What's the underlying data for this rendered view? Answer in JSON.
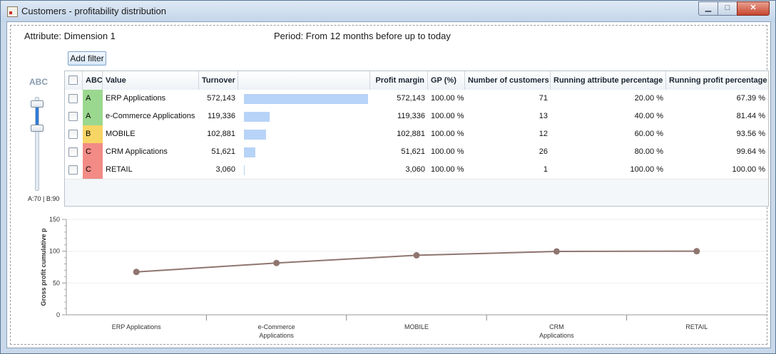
{
  "window": {
    "title": "Customers - profitability distribution",
    "minimize": "▁",
    "maximize": "□",
    "close": "✕"
  },
  "header": {
    "attribute": "Attribute: Dimension 1",
    "period": "Period: From 12 months before up to today"
  },
  "toolbar": {
    "add_filter": "Add filter"
  },
  "abc_slider": {
    "label": "ABC",
    "readout": "A:70 | B:90",
    "a_threshold": 70,
    "b_threshold": 90
  },
  "colors": {
    "A": "#9bd88f",
    "B": "#f7d565",
    "C": "#f28b85",
    "turnover_bar": "#b7d3f7",
    "line": "#8f7570"
  },
  "table": {
    "columns": {
      "abc": "ABC",
      "value": "Value",
      "turnover": "Turnover",
      "profit_margin": "Profit margin",
      "gp": "GP (%)",
      "customers": "Number of customers",
      "running_attr": "Running attribute percentage",
      "running_profit": "Running profit percentage"
    },
    "rows": [
      {
        "abc": "A",
        "value": "ERP Applications",
        "turnover": "572,143",
        "turnover_raw": 572143,
        "profit_margin": "572,143",
        "gp": "100.00 %",
        "customers": "71",
        "running_attr": "20.00 %",
        "running_profit": "67.39 %"
      },
      {
        "abc": "A",
        "value": "e-Commerce Applications",
        "turnover": "119,336",
        "turnover_raw": 119336,
        "profit_margin": "119,336",
        "gp": "100.00 %",
        "customers": "13",
        "running_attr": "40.00 %",
        "running_profit": "81.44 %"
      },
      {
        "abc": "B",
        "value": "MOBILE",
        "turnover": "102,881",
        "turnover_raw": 102881,
        "profit_margin": "102,881",
        "gp": "100.00 %",
        "customers": "12",
        "running_attr": "60.00 %",
        "running_profit": "93.56 %"
      },
      {
        "abc": "C",
        "value": "CRM Applications",
        "turnover": "51,621",
        "turnover_raw": 51621,
        "profit_margin": "51,621",
        "gp": "100.00 %",
        "customers": "26",
        "running_attr": "80.00 %",
        "running_profit": "99.64 %"
      },
      {
        "abc": "C",
        "value": "RETAIL",
        "turnover": "3,060",
        "turnover_raw": 3060,
        "profit_margin": "3,060",
        "gp": "100.00 %",
        "customers": "1",
        "running_attr": "100.00 %",
        "running_profit": "100.00 %"
      }
    ]
  },
  "chart_data": {
    "type": "line",
    "ylabel": "Gross profit cumulative p",
    "xlabel": "",
    "categories": [
      "ERP Applications",
      "e-Commerce Applications",
      "MOBILE",
      "CRM Applications",
      "RETAIL"
    ],
    "series": [
      {
        "values": [
          67.39,
          81.44,
          93.56,
          99.64,
          100.0
        ]
      }
    ],
    "ylim": [
      0,
      150
    ],
    "yticks": [
      0,
      50,
      100,
      150
    ],
    "grid": true
  }
}
